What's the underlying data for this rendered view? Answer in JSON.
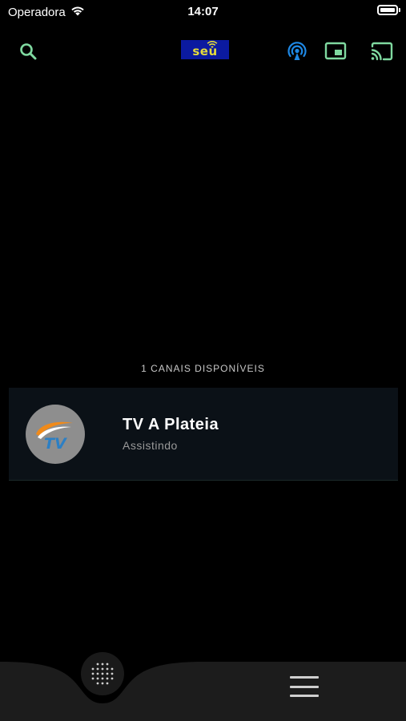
{
  "status_bar": {
    "carrier": "Operadora",
    "time": "14:07"
  },
  "toolbar": {
    "logo_text": "seu",
    "icons": [
      "search-icon",
      "live-broadcast-icon",
      "picture-in-picture-icon",
      "cast-icon"
    ]
  },
  "colors": {
    "accent_green": "#7fd9a0",
    "accent_blue": "#1e88e5",
    "logo_bg": "#0b1aa0",
    "logo_text": "#e5dc3a",
    "card_bg": "#0b1117"
  },
  "channels": {
    "count_label": "1 CANAIS DISPONÍVEIS",
    "items": [
      {
        "name": "TV A Plateia",
        "status": "Assistindo",
        "logo_text": "TV"
      }
    ]
  },
  "bottom_bar": {
    "icons": [
      "dot-grid-icon",
      "menu-icon"
    ]
  }
}
